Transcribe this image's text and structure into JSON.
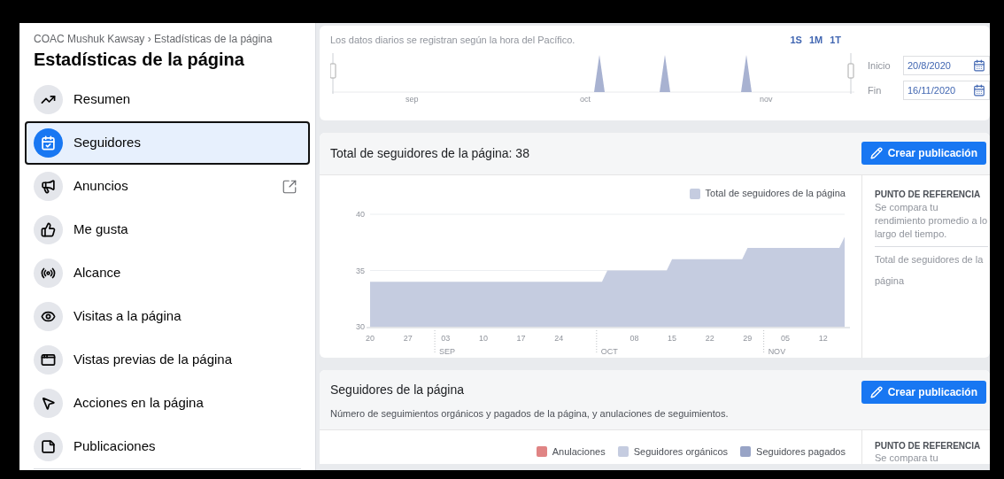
{
  "sidebar": {
    "breadcrumb": "COAC Mushuk Kawsay › Estadísticas de la página",
    "title": "Estadísticas de la página",
    "items": [
      {
        "label": "Resumen",
        "selected": false,
        "external": false
      },
      {
        "label": "Seguidores",
        "selected": true,
        "external": false
      },
      {
        "label": "Anuncios",
        "selected": false,
        "external": true
      },
      {
        "label": "Me gusta",
        "selected": false,
        "external": false
      },
      {
        "label": "Alcance",
        "selected": false,
        "external": false
      },
      {
        "label": "Visitas a la página",
        "selected": false,
        "external": false
      },
      {
        "label": "Vistas previas de la página",
        "selected": false,
        "external": false
      },
      {
        "label": "Acciones en la página",
        "selected": false,
        "external": false
      },
      {
        "label": "Publicaciones",
        "selected": false,
        "external": false
      }
    ]
  },
  "range": {
    "note": "Los datos diarios se registran según la hora del Pacífico.",
    "periods": [
      "1S",
      "1M",
      "1T"
    ],
    "months": [
      "sep",
      "oct",
      "nov"
    ],
    "start": {
      "label": "Inicio",
      "value": "20/8/2020"
    },
    "end": {
      "label": "Fin",
      "value": "16/11/2020"
    }
  },
  "total_card": {
    "title": "Total de seguidores de la página: 38",
    "button": "Crear publicación",
    "chart_data": {
      "type": "area",
      "categories": [
        "20",
        null,
        null,
        null,
        null,
        null,
        null,
        "27",
        null,
        null,
        null,
        null,
        null,
        null,
        "03",
        null,
        null,
        null,
        null,
        null,
        null,
        "10",
        null,
        null,
        null,
        null,
        null,
        null,
        "17",
        null,
        null,
        null,
        null,
        null,
        null,
        "24",
        null,
        null,
        null,
        null,
        null,
        null,
        null,
        null,
        null,
        null,
        null,
        null,
        null,
        "08",
        null,
        null,
        null,
        null,
        null,
        null,
        "15",
        null,
        null,
        null,
        null,
        null,
        null,
        "22",
        null,
        null,
        null,
        null,
        null,
        null,
        "29",
        null,
        null,
        null,
        null,
        null,
        null,
        "05",
        null,
        null,
        null,
        null,
        null,
        null,
        "12",
        null,
        null,
        null,
        null
      ],
      "series": [
        {
          "name": "Total de seguidores de la página",
          "color": "#c5cce0",
          "values": [
            34,
            34,
            34,
            34,
            34,
            34,
            34,
            34,
            34,
            34,
            34,
            34,
            34,
            34,
            34,
            34,
            34,
            34,
            34,
            34,
            34,
            34,
            34,
            34,
            34,
            34,
            34,
            34,
            34,
            34,
            34,
            34,
            34,
            34,
            34,
            34,
            34,
            34,
            34,
            34,
            34,
            34,
            34,
            34,
            35,
            35,
            35,
            35,
            35,
            35,
            35,
            35,
            35,
            35,
            35,
            35,
            36,
            36,
            36,
            36,
            36,
            36,
            36,
            36,
            36,
            36,
            36,
            36,
            36,
            36,
            37,
            37,
            37,
            37,
            37,
            37,
            37,
            37,
            37,
            37,
            37,
            37,
            37,
            37,
            37,
            37,
            37,
            37,
            38
          ]
        }
      ],
      "ylim": [
        30,
        40
      ],
      "yticks": [
        30,
        35,
        40
      ],
      "annotations": [
        "SEP",
        "OCT",
        "NOV"
      ]
    },
    "benchmark": {
      "heading": "PUNTO DE REFERENCIA",
      "text": "Se compara tu rendimiento promedio a lo largo del tiempo.",
      "metric": "Total de seguidores de la página"
    }
  },
  "followers_card": {
    "title": "Seguidores de la página",
    "subtitle": "Número de seguimientos orgánicos y pagados de la página, y anulaciones de seguimientos.",
    "button": "Crear publicación",
    "legend": [
      {
        "label": "Anulaciones",
        "color": "#e08484"
      },
      {
        "label": "Seguidores orgánicos",
        "color": "#c5cce0"
      },
      {
        "label": "Seguidores pagados",
        "color": "#98a4c6"
      }
    ],
    "benchmark": {
      "heading": "PUNTO DE REFERENCIA",
      "text": "Se compara tu"
    }
  }
}
